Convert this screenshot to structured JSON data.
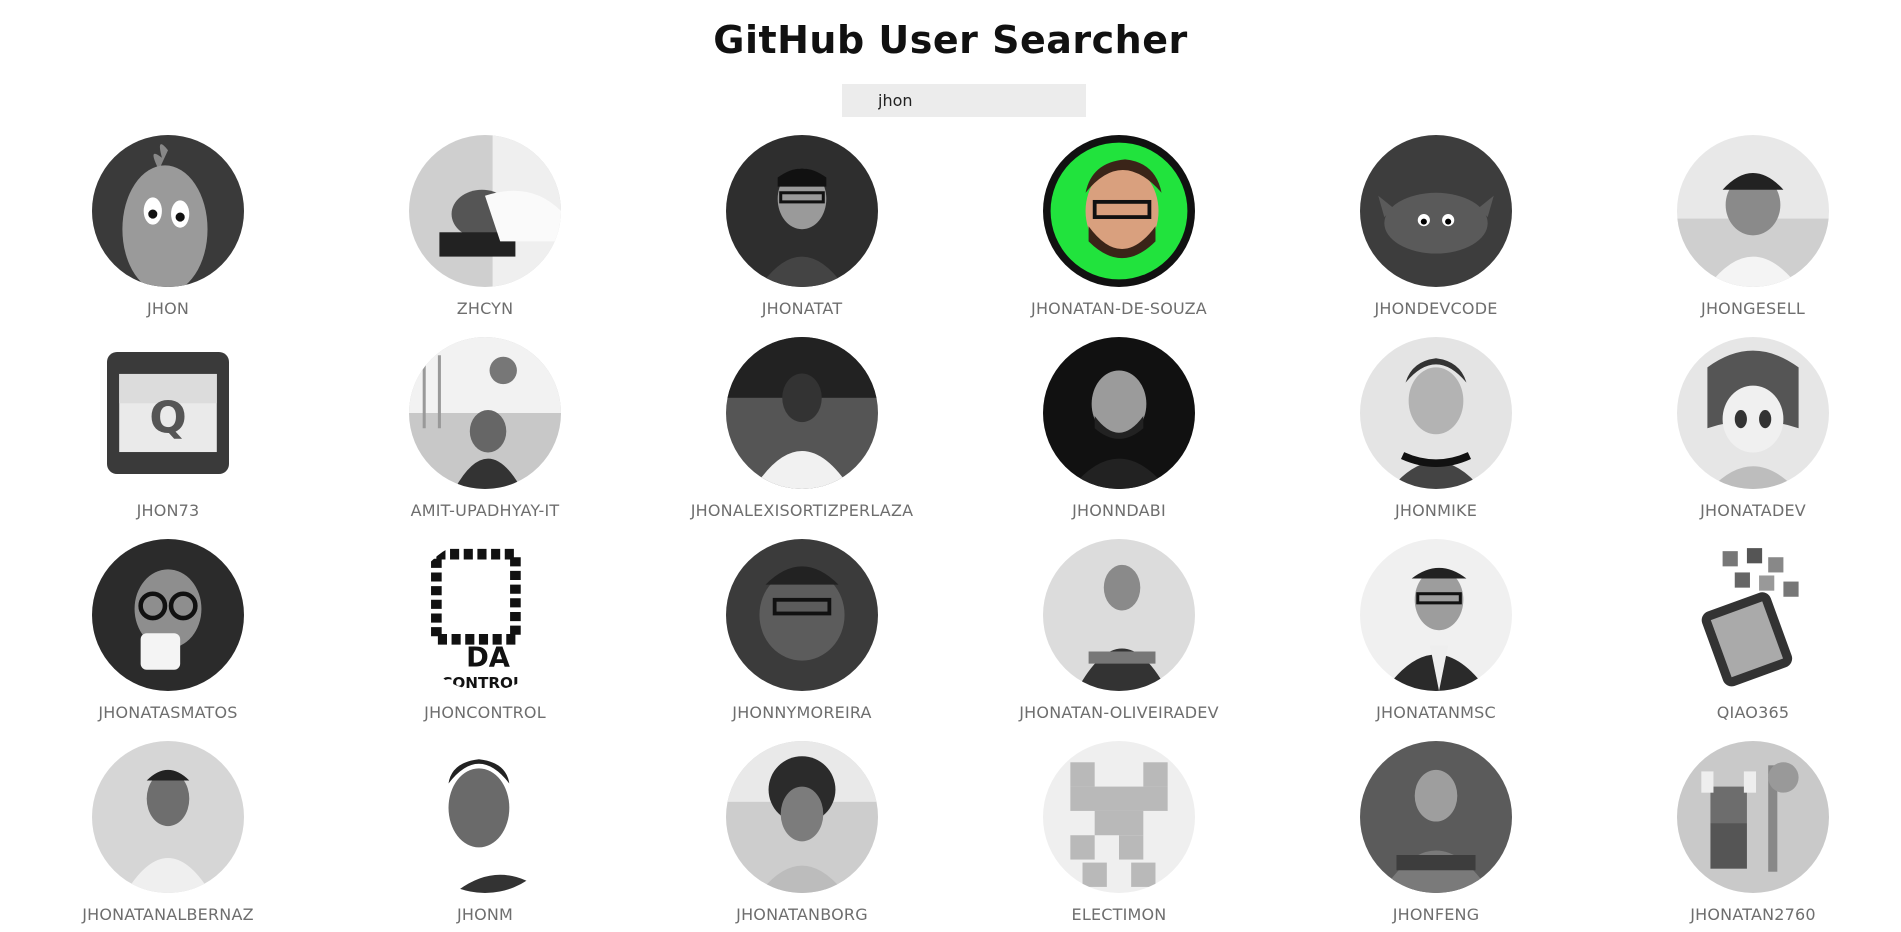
{
  "header": {
    "title": "GitHub User Searcher"
  },
  "search": {
    "value": "jhon"
  },
  "users": [
    {
      "login": "jhon",
      "avatar_icon": "carrot-cartoon-avatar"
    },
    {
      "login": "zhcyn",
      "avatar_icon": "person-on-laptop-avatar"
    },
    {
      "login": "jhonatat",
      "avatar_icon": "man-with-glasses-avatar"
    },
    {
      "login": "jhonatan-de-souza",
      "avatar_icon": "bearded-man-green-background-avatar"
    },
    {
      "login": "jhondevcode",
      "avatar_icon": "crab-mascot-avatar"
    },
    {
      "login": "jhongesell",
      "avatar_icon": "man-in-cap-avatar"
    },
    {
      "login": "jhon73",
      "avatar_icon": "letter-q-app-icon-avatar"
    },
    {
      "login": "amit-upadhyay-it",
      "avatar_icon": "basketball-player-avatar"
    },
    {
      "login": "jhonalexisortizperlaza",
      "avatar_icon": "man-in-white-shirt-avatar"
    },
    {
      "login": "jhonndabi",
      "avatar_icon": "bearded-man-avatar"
    },
    {
      "login": "jhonmike",
      "avatar_icon": "smiling-man-headphones-avatar"
    },
    {
      "login": "jhonatadev",
      "avatar_icon": "anime-character-avatar"
    },
    {
      "login": "jhonatasmatos",
      "avatar_icon": "man-drinking-coffee-avatar"
    },
    {
      "login": "jhoncontrol",
      "avatar_icon": "control-logo-avatar"
    },
    {
      "login": "jhonnymoreira",
      "avatar_icon": "man-with-glasses-dark-avatar"
    },
    {
      "login": "jhonatan-oliveiradev",
      "avatar_icon": "man-arms-crossed-avatar"
    },
    {
      "login": "jhonatanmsc",
      "avatar_icon": "man-in-suit-avatar"
    },
    {
      "login": "qiao365",
      "avatar_icon": "smartphone-apps-avatar"
    },
    {
      "login": "jhonatanalbernaz",
      "avatar_icon": "young-man-avatar"
    },
    {
      "login": "jhonm",
      "avatar_icon": "man-portrait-avatar"
    },
    {
      "login": "jhonatanborg",
      "avatar_icon": "curly-hair-man-avatar"
    },
    {
      "login": "electimon",
      "avatar_icon": "identicon-avatar"
    },
    {
      "login": "jhonfeng",
      "avatar_icon": "man-arms-crossed-dark-avatar"
    },
    {
      "login": "jhonatan2760",
      "avatar_icon": "pixel-viking-avatar"
    }
  ]
}
